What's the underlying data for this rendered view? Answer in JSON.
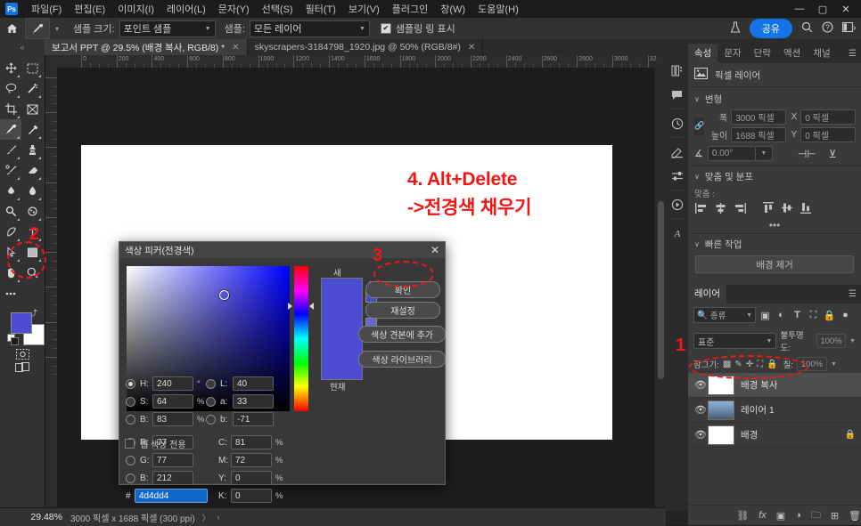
{
  "app": {
    "logo": "Ps",
    "menus": [
      "파일(F)",
      "편집(E)",
      "이미지(I)",
      "레이어(L)",
      "문자(Y)",
      "선택(S)",
      "필터(T)",
      "보기(V)",
      "플러그인",
      "창(W)",
      "도움말(H)"
    ],
    "window_controls": [
      "—",
      "▢",
      "✕"
    ]
  },
  "options_bar": {
    "home_icon": "home-icon",
    "tool_icon": "eyedropper-icon",
    "sample_size_label": "샘플 크기:",
    "sample_size_value": "포인트 샘플",
    "sample_label": "샘플:",
    "sample_value": "모든 레이어",
    "sampling_ring_label": "샘플링 링 표시",
    "sampling_ring_checked": true,
    "share_label": "공유",
    "right_icons": [
      "flask-icon",
      "search-icon",
      "help-icon",
      "workspace-icon"
    ]
  },
  "document_tabs": [
    {
      "label": "보고서 PPT @ 29.5% (배경 복사, RGB/8) *",
      "active": true
    },
    {
      "label": "skyscrapers-3184798_1920.jpg @ 50% (RGB/8#)",
      "active": false
    }
  ],
  "ruler": {
    "h_ticks": [
      "0",
      "200",
      "400",
      "600",
      "800",
      "1000",
      "1200",
      "1400",
      "1600",
      "1800",
      "2000",
      "2200",
      "2400",
      "2600",
      "2800",
      "3000",
      "32"
    ],
    "v_ticks": [
      "0",
      "200",
      "400",
      "600",
      "800",
      "1000",
      "1200",
      "1400",
      "1600"
    ]
  },
  "toolbar": {
    "tools": [
      "move-tool",
      "marquee-tool",
      "lasso-tool",
      "magic-wand-tool",
      "crop-tool",
      "frame-tool",
      "eyedropper-tool",
      "spot-healing-tool",
      "brush-tool",
      "clone-stamp-tool",
      "history-brush-tool",
      "eraser-tool",
      "gradient-tool",
      "blur-tool",
      "dodge-tool",
      "pen-tool",
      "type-tool",
      "path-selection-tool",
      "shape-tool",
      "hand-tool",
      "zoom-tool",
      "more-tools"
    ],
    "selected_tool": "eyedropper-tool",
    "foreground_color": "#4d4dd4",
    "background_color": "#ffffff",
    "quick_mask": "quick-mask-icon",
    "screen_mode": "screen-mode-icon"
  },
  "canvas": {
    "background": "#ffffff",
    "annotations": [
      {
        "text": "4. Alt+Delete",
        "color": "#f41414"
      },
      {
        "text": "->전경색 채우기",
        "color": "#f41414"
      }
    ]
  },
  "status_bar": {
    "zoom": "29.48%",
    "doc_size": "3000 픽셀 x 1688 픽셀 (300 ppi)",
    "arrow": "〉"
  },
  "dock_icons": [
    "libraries-icon",
    "comments-icon",
    "history-icon",
    "adjustments-icon",
    "properties-sliders-icon",
    "actions-icon",
    "glyphs-icon"
  ],
  "properties_panel": {
    "tabs": [
      {
        "label": "속성",
        "active": true
      },
      {
        "label": "문자",
        "active": false
      },
      {
        "label": "단락",
        "active": false
      },
      {
        "label": "액션",
        "active": false
      },
      {
        "label": "채널",
        "active": false
      }
    ],
    "layer_type_icon": "pixel-layer-icon",
    "layer_type": "픽셀 레이어",
    "transform_section": "변형",
    "link_icon": "link-icon",
    "width_label": "폭",
    "width_value": "3000 픽셀",
    "x_label": "X",
    "x_value": "0 픽셀",
    "height_label": "높이",
    "height_value": "1688 픽셀",
    "y_label": "Y",
    "y_value": "0 픽셀",
    "angle_icon": "angle-icon",
    "angle_value": "0.00°",
    "flip_h_icon": "flip-horizontal-icon",
    "flip_v_icon": "flip-vertical-icon",
    "align_section": "맞춤 및 분포",
    "align_label": "맞춤 :",
    "align_icons": [
      "align-left-icon",
      "align-center-h-icon",
      "align-right-icon",
      "align-top-icon",
      "align-center-v-icon",
      "align-bottom-icon"
    ],
    "more_icon": "more-options-icon",
    "quick_actions_section": "빠른 작업",
    "remove_bg_label": "배경 제거"
  },
  "layers_panel": {
    "tab_label": "레이어",
    "menu_icon": "panel-menu-icon",
    "filter_icon": "search-icon",
    "filter_value": "종류",
    "filter_type_icons": [
      "pixel-filter-icon",
      "adjustment-filter-icon",
      "type-filter-icon",
      "shape-filter-icon",
      "smart-object-filter-icon"
    ],
    "filter_toggle_icon": "filter-power-icon",
    "blend_mode": "표준",
    "opacity_label": "불투명도:",
    "opacity_value": "100%",
    "lock_label": "잠그기:",
    "lock_icons": [
      "lock-transparent-icon",
      "lock-image-icon",
      "lock-position-icon",
      "lock-artboard-icon",
      "lock-all-icon"
    ],
    "fill_label": "칠:",
    "fill_value": "100%",
    "layers": [
      {
        "name": "배경 복사",
        "visible": true,
        "selected": true,
        "thumb": "#ffffff",
        "locked": false
      },
      {
        "name": "레이어 1",
        "visible": true,
        "selected": false,
        "thumb": "#6a86a8",
        "locked": false
      },
      {
        "name": "배경",
        "visible": true,
        "selected": false,
        "thumb": "#ffffff",
        "locked": true
      }
    ],
    "footer_icons": [
      "link-layers-icon",
      "layer-style-icon",
      "layer-mask-icon",
      "adjustment-layer-icon",
      "new-group-icon",
      "new-layer-icon",
      "delete-layer-icon"
    ]
  },
  "color_picker": {
    "title": "색상 피커(전경색)",
    "close_icon": "close-icon",
    "new_label": "새",
    "current_label": "현재",
    "new_color": "#4d4dd4",
    "current_color": "#4d4dd4",
    "gamut_warning_icon": "gamut-warning-icon",
    "web_warning_icon": "web-warning-icon",
    "buttons": [
      "확인",
      "재설정",
      "색상 견본에 추가",
      "색상 라이브러리"
    ],
    "web_only_label": "웹 색상 전용",
    "web_only_checked": false,
    "hex_symbol": "#",
    "hex_value": "4d4dd4",
    "fields": [
      {
        "label": "H:",
        "value": "240",
        "unit": "°",
        "radio": true,
        "col": "left"
      },
      {
        "label": "S:",
        "value": "64",
        "unit": "%",
        "radio": false,
        "col": "left"
      },
      {
        "label": "B:",
        "value": "83",
        "unit": "%",
        "radio": false,
        "col": "left"
      },
      {
        "label": "R:",
        "value": "77",
        "unit": "",
        "radio": false,
        "col": "left"
      },
      {
        "label": "G:",
        "value": "77",
        "unit": "",
        "radio": false,
        "col": "left"
      },
      {
        "label": "B:",
        "value": "212",
        "unit": "",
        "radio": false,
        "col": "left"
      },
      {
        "label": "L:",
        "value": "40",
        "unit": "",
        "radio": false,
        "col": "right"
      },
      {
        "label": "a:",
        "value": "33",
        "unit": "",
        "radio": false,
        "col": "right"
      },
      {
        "label": "b:",
        "value": "-71",
        "unit": "",
        "radio": false,
        "col": "right"
      },
      {
        "label": "C:",
        "value": "81",
        "unit": "%",
        "radio": null,
        "col": "right"
      },
      {
        "label": "M:",
        "value": "72",
        "unit": "%",
        "radio": null,
        "col": "right"
      },
      {
        "label": "Y:",
        "value": "0",
        "unit": "%",
        "radio": null,
        "col": "right"
      },
      {
        "label": "K:",
        "value": "0",
        "unit": "%",
        "radio": null,
        "col": "right"
      }
    ]
  },
  "step_markers": [
    {
      "number": "1",
      "target": "layer-배경-복사"
    },
    {
      "number": "2",
      "target": "foreground-color-swatch"
    },
    {
      "number": "3",
      "target": "color-picker-ok-button"
    }
  ]
}
